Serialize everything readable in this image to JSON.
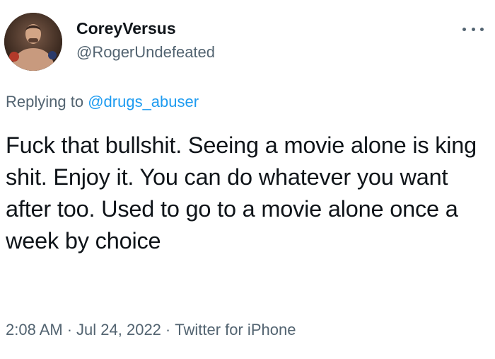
{
  "author": {
    "display_name": "CoreyVersus",
    "handle": "@RogerUndefeated"
  },
  "reply": {
    "prefix": "Replying to",
    "mention": "@drugs_abuser"
  },
  "tweet": {
    "text": "Fuck that bullshit. Seeing a movie alone is king shit. Enjoy it. You can do whatever you want after too. Used to go to a movie alone once a week by choice"
  },
  "meta": {
    "time": "2:08 AM",
    "date": "Jul 24, 2022",
    "source": "Twitter for iPhone",
    "separator": "·"
  },
  "icons": {
    "more": "more-options-icon"
  },
  "colors": {
    "text": "#0f1419",
    "secondary": "#536471",
    "accent": "#1d9bf0"
  }
}
